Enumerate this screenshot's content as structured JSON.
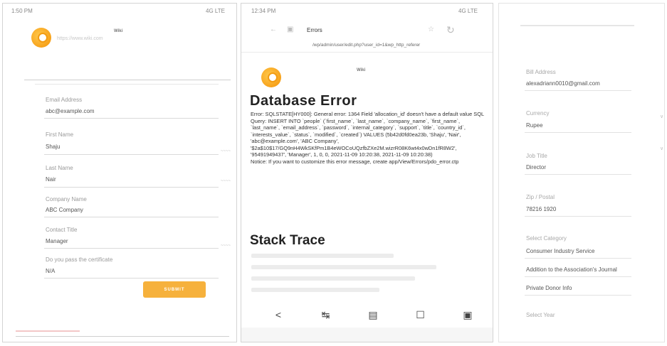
{
  "panel1": {
    "status_time": "1:50 PM",
    "status_right": "4G LTE",
    "logo_label": "Wiki",
    "logo_sub": "https://www.wiki.com",
    "fields": [
      {
        "label": "Email Address",
        "value": "abc@example.com"
      },
      {
        "label": "First Name",
        "value": "Shaju"
      },
      {
        "label": "Last Name",
        "value": "Nair"
      },
      {
        "label": "Company Name",
        "value": "ABC Company"
      },
      {
        "label": "Contact Title",
        "value": "Manager"
      },
      {
        "label": "Do you pass the certificate",
        "value": "N/A"
      }
    ],
    "side_marks": [
      "~~~~",
      "~~~~",
      "~~~~"
    ],
    "submit_label": "SUBMIT"
  },
  "panel2": {
    "status_time": "12:34 PM",
    "status_right": "4G LTE",
    "tab_title": "Errors",
    "url": "/wp/admin/user/edit.php?user_id=1&wp_http_referer",
    "logo_label": "Wiki",
    "title": "Database Error",
    "error_text": "Error: SQLSTATE[HY000]: General error: 1364 Field 'allocation_id' doesn't have a default value SQL Query: INSERT INTO `people` (`first_name`, `last_name`, `company_name`, `first_name`, `last_name`, `email_address`, `password`, `internal_category`, `support`, `title`, `country_id`, `interests_value`, `status`, `modified`, `created`) VALUES (5b42d0fd0ea23b, 'Shaju', 'Nair', 'abc@example.com', 'ABC Company', '$2a$10$17/GQ9nH4WkSKfPm1B4eWOCoUQzfbZXe2M.wizrR08K6wt4x0wDn1fR8W2', '95491949437', 'Manager', 1, 0, 0, 2021-11-09 10:20:38, 2021-11-09 10:20:38)",
    "notice_text": "Notice: If you want to customize this error message, create app/View/Errors/pdo_error.ctp",
    "stack_title": "Stack Trace",
    "nav_buttons": [
      "<",
      "↹",
      "▤",
      "☐",
      "▣"
    ]
  },
  "panel3": {
    "fields": [
      {
        "label": "Bill Address",
        "value": "alexadriann0010@gmail.com"
      },
      {
        "label": "Currency",
        "value": "Rupee"
      },
      {
        "label": "Job Title",
        "value": "Director"
      },
      {
        "label": "Zip / Postal",
        "value": "78216 1920"
      },
      {
        "label": "Select Category",
        "value": "Consumer Industry Service"
      },
      {
        "label": "",
        "value": "Addition to the Association's Journal"
      },
      {
        "label": "",
        "value": "Private Donor Info"
      },
      {
        "label": "Select Year",
        "value": ""
      }
    ]
  }
}
